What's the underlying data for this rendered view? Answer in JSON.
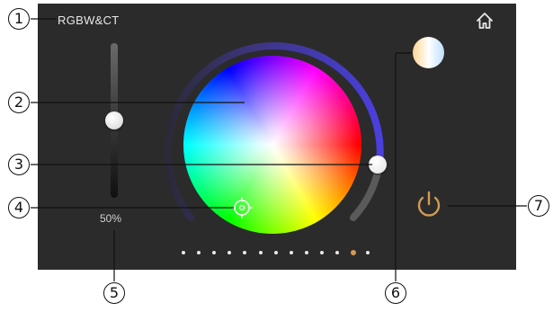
{
  "header": {
    "mode_title": "RGBW&CT"
  },
  "brightness": {
    "percent_label": "50%",
    "level": 0.5
  },
  "icons": {
    "home": "home-icon",
    "power": "power-icon",
    "picker": "crosshair-target-icon"
  },
  "pager": {
    "total": 13,
    "active_index": 11
  },
  "callouts": [
    "1",
    "2",
    "3",
    "4",
    "5",
    "6",
    "7"
  ],
  "colors": {
    "panel": "#2b2b2b",
    "power_accent": "#d29a55",
    "ring_accent": "#4b3fe0"
  }
}
